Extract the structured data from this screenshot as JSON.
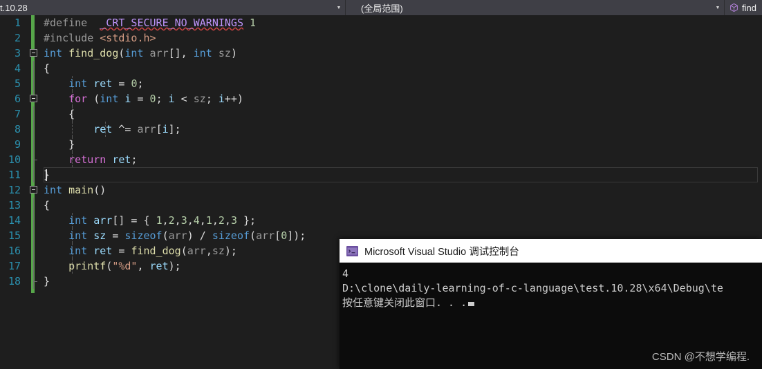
{
  "window": {
    "nav": {
      "project_scope": "t.10.28",
      "namespace_scope": "(全局范围)",
      "member_scope": "find",
      "cube_icon": "cube-icon",
      "caret_icon": "chevron-down-icon"
    }
  },
  "editor": {
    "lines": [
      {
        "no": "1",
        "indent": 0,
        "fold": "none",
        "guides": [],
        "tokens": [
          {
            "t": "#define ",
            "c": "k-pre"
          },
          {
            "t": " ",
            "c": "k-plain"
          },
          {
            "t": "_CRT_SECURE_NO_WARNINGS",
            "c": "k-macro squiggle"
          },
          {
            "t": " ",
            "c": "k-plain"
          },
          {
            "t": "1",
            "c": "k-num"
          }
        ]
      },
      {
        "no": "2",
        "indent": 0,
        "fold": "none",
        "guides": [],
        "tokens": [
          {
            "t": "#include ",
            "c": "k-pre"
          },
          {
            "t": "<stdio.h>",
            "c": "k-str"
          }
        ]
      },
      {
        "no": "3",
        "indent": 0,
        "fold": "box",
        "guides": [],
        "tokens": [
          {
            "t": "int",
            "c": "k-blue"
          },
          {
            "t": " ",
            "c": "k-plain"
          },
          {
            "t": "find_dog",
            "c": "k-func"
          },
          {
            "t": "(",
            "c": "k-punct"
          },
          {
            "t": "int",
            "c": "k-blue"
          },
          {
            "t": " ",
            "c": "k-plain"
          },
          {
            "t": "arr",
            "c": "k-gray"
          },
          {
            "t": "[], ",
            "c": "k-punct"
          },
          {
            "t": "int",
            "c": "k-blue"
          },
          {
            "t": " ",
            "c": "k-plain"
          },
          {
            "t": "sz",
            "c": "k-gray"
          },
          {
            "t": ")",
            "c": "k-punct"
          }
        ]
      },
      {
        "no": "4",
        "indent": 0,
        "fold": "line",
        "guides": [],
        "tokens": [
          {
            "t": "{",
            "c": "k-brace"
          }
        ]
      },
      {
        "no": "5",
        "indent": 0,
        "fold": "line",
        "guides": [
          "ig2"
        ],
        "tokens": [
          {
            "t": "    ",
            "c": "k-plain"
          },
          {
            "t": "int",
            "c": "k-blue"
          },
          {
            "t": " ",
            "c": "k-plain"
          },
          {
            "t": "ret",
            "c": "k-var"
          },
          {
            "t": " = ",
            "c": "k-punct"
          },
          {
            "t": "0",
            "c": "k-num"
          },
          {
            "t": ";",
            "c": "k-punct"
          }
        ]
      },
      {
        "no": "6",
        "indent": 0,
        "fold": "box2",
        "guides": [
          "ig2"
        ],
        "tokens": [
          {
            "t": "    ",
            "c": "k-plain"
          },
          {
            "t": "for",
            "c": "k-pink"
          },
          {
            "t": " (",
            "c": "k-punct"
          },
          {
            "t": "int",
            "c": "k-blue"
          },
          {
            "t": " ",
            "c": "k-plain"
          },
          {
            "t": "i",
            "c": "k-var"
          },
          {
            "t": " = ",
            "c": "k-punct"
          },
          {
            "t": "0",
            "c": "k-num"
          },
          {
            "t": "; ",
            "c": "k-punct"
          },
          {
            "t": "i",
            "c": "k-var"
          },
          {
            "t": " < ",
            "c": "k-punct"
          },
          {
            "t": "sz",
            "c": "k-gray"
          },
          {
            "t": "; ",
            "c": "k-punct"
          },
          {
            "t": "i",
            "c": "k-var"
          },
          {
            "t": "++)",
            "c": "k-punct"
          }
        ]
      },
      {
        "no": "7",
        "indent": 0,
        "fold": "line",
        "guides": [
          "ig2"
        ],
        "tokens": [
          {
            "t": "    {",
            "c": "k-brace"
          }
        ]
      },
      {
        "no": "8",
        "indent": 0,
        "fold": "line",
        "guides": [
          "ig2",
          "ig3"
        ],
        "tokens": [
          {
            "t": "        ",
            "c": "k-plain"
          },
          {
            "t": "ret",
            "c": "k-var"
          },
          {
            "t": " ^= ",
            "c": "k-punct"
          },
          {
            "t": "arr",
            "c": "k-gray"
          },
          {
            "t": "[",
            "c": "k-punct"
          },
          {
            "t": "i",
            "c": "k-var"
          },
          {
            "t": "];",
            "c": "k-punct"
          }
        ]
      },
      {
        "no": "9",
        "indent": 0,
        "fold": "line",
        "guides": [
          "ig2"
        ],
        "tokens": [
          {
            "t": "    }",
            "c": "k-brace"
          }
        ]
      },
      {
        "no": "10",
        "indent": 0,
        "fold": "lineend",
        "guides": [
          "ig2"
        ],
        "tokens": [
          {
            "t": "    ",
            "c": "k-plain"
          },
          {
            "t": "return",
            "c": "k-pink"
          },
          {
            "t": " ",
            "c": "k-plain"
          },
          {
            "t": "ret",
            "c": "k-var"
          },
          {
            "t": ";",
            "c": "k-punct"
          }
        ]
      },
      {
        "no": "11",
        "indent": 0,
        "fold": "line",
        "guides": [],
        "current": true,
        "tokens": [
          {
            "t": "}",
            "c": "k-brace"
          }
        ]
      },
      {
        "no": "12",
        "indent": 0,
        "fold": "box",
        "guides": [],
        "tokens": [
          {
            "t": "int",
            "c": "k-blue"
          },
          {
            "t": " ",
            "c": "k-plain"
          },
          {
            "t": "main",
            "c": "k-func"
          },
          {
            "t": "()",
            "c": "k-punct"
          }
        ]
      },
      {
        "no": "13",
        "indent": 0,
        "fold": "line",
        "guides": [],
        "tokens": [
          {
            "t": "{",
            "c": "k-brace"
          }
        ]
      },
      {
        "no": "14",
        "indent": 0,
        "fold": "line",
        "guides": [
          "ig2"
        ],
        "tokens": [
          {
            "t": "    ",
            "c": "k-plain"
          },
          {
            "t": "int",
            "c": "k-blue"
          },
          {
            "t": " ",
            "c": "k-plain"
          },
          {
            "t": "arr",
            "c": "k-var"
          },
          {
            "t": "[] = { ",
            "c": "k-punct"
          },
          {
            "t": "1",
            "c": "k-num"
          },
          {
            "t": ",",
            "c": "k-punct"
          },
          {
            "t": "2",
            "c": "k-num"
          },
          {
            "t": ",",
            "c": "k-punct"
          },
          {
            "t": "3",
            "c": "k-num"
          },
          {
            "t": ",",
            "c": "k-punct"
          },
          {
            "t": "4",
            "c": "k-num"
          },
          {
            "t": ",",
            "c": "k-punct"
          },
          {
            "t": "1",
            "c": "k-num"
          },
          {
            "t": ",",
            "c": "k-punct"
          },
          {
            "t": "2",
            "c": "k-num"
          },
          {
            "t": ",",
            "c": "k-punct"
          },
          {
            "t": "3",
            "c": "k-num"
          },
          {
            "t": " };",
            "c": "k-punct"
          }
        ]
      },
      {
        "no": "15",
        "indent": 0,
        "fold": "line",
        "guides": [
          "ig2"
        ],
        "tokens": [
          {
            "t": "    ",
            "c": "k-plain"
          },
          {
            "t": "int",
            "c": "k-blue"
          },
          {
            "t": " ",
            "c": "k-plain"
          },
          {
            "t": "sz",
            "c": "k-var"
          },
          {
            "t": " = ",
            "c": "k-punct"
          },
          {
            "t": "sizeof",
            "c": "k-blue"
          },
          {
            "t": "(",
            "c": "k-punct"
          },
          {
            "t": "arr",
            "c": "k-gray"
          },
          {
            "t": ") / ",
            "c": "k-punct"
          },
          {
            "t": "sizeof",
            "c": "k-blue"
          },
          {
            "t": "(",
            "c": "k-punct"
          },
          {
            "t": "arr",
            "c": "k-gray"
          },
          {
            "t": "[",
            "c": "k-punct"
          },
          {
            "t": "0",
            "c": "k-num"
          },
          {
            "t": "]);",
            "c": "k-punct"
          }
        ]
      },
      {
        "no": "16",
        "indent": 0,
        "fold": "line",
        "guides": [
          "ig2"
        ],
        "tokens": [
          {
            "t": "    ",
            "c": "k-plain"
          },
          {
            "t": "int",
            "c": "k-blue"
          },
          {
            "t": " ",
            "c": "k-plain"
          },
          {
            "t": "ret",
            "c": "k-var"
          },
          {
            "t": " = ",
            "c": "k-punct"
          },
          {
            "t": "find_dog",
            "c": "k-func"
          },
          {
            "t": "(",
            "c": "k-punct"
          },
          {
            "t": "arr",
            "c": "k-gray"
          },
          {
            "t": ",",
            "c": "k-punct"
          },
          {
            "t": "sz",
            "c": "k-gray"
          },
          {
            "t": ");",
            "c": "k-punct"
          }
        ]
      },
      {
        "no": "17",
        "indent": 0,
        "fold": "line",
        "guides": [
          "ig2"
        ],
        "tokens": [
          {
            "t": "    ",
            "c": "k-plain"
          },
          {
            "t": "printf",
            "c": "k-func"
          },
          {
            "t": "(",
            "c": "k-punct"
          },
          {
            "t": "\"%d\"",
            "c": "k-str"
          },
          {
            "t": ", ",
            "c": "k-punct"
          },
          {
            "t": "ret",
            "c": "k-var"
          },
          {
            "t": ");",
            "c": "k-punct"
          }
        ]
      },
      {
        "no": "18",
        "indent": 0,
        "fold": "lineend",
        "guides": [],
        "tokens": [
          {
            "t": "}",
            "c": "k-brace"
          }
        ]
      }
    ]
  },
  "console": {
    "icon": "console-app-icon",
    "title": "Microsoft Visual Studio 调试控制台",
    "output": [
      "4",
      "D:\\clone\\daily-learning-of-c-language\\test.10.28\\x64\\Debug\\te",
      "按任意键关闭此窗口. . ."
    ]
  },
  "watermark": {
    "text": "CSDN @不想学编程."
  },
  "colors": {
    "editor_bg": "#1e1e1e",
    "nav_bg": "#3f3f46",
    "saved_margin_green": "#57a64a",
    "linenumber": "#2b91af",
    "console_bg": "#0c0c0c",
    "console_titlebar": "#ffffff",
    "keyword_blue": "#569cd6",
    "keyword_pink": "#d670d6",
    "function_yellow": "#dcdcaa",
    "number_green": "#b5cea8",
    "string_orange": "#d69d85",
    "macro_purple": "#bd93f9"
  }
}
